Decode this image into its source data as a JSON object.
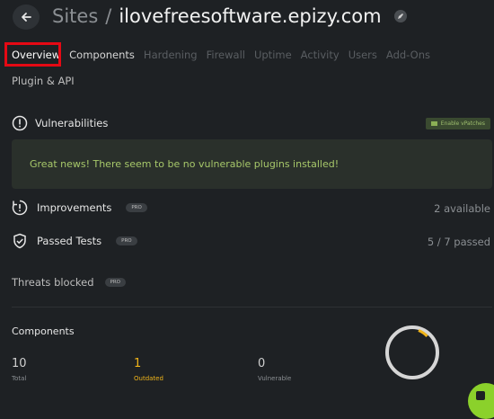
{
  "header": {
    "sites_label": "Sites",
    "separator": "/",
    "domain": "ilovefreesoftware.epizy.com"
  },
  "tabs": [
    {
      "label": "Overview",
      "state": "active"
    },
    {
      "label": "Components",
      "state": "light"
    },
    {
      "label": "Hardening",
      "state": "dim"
    },
    {
      "label": "Firewall",
      "state": "dim"
    },
    {
      "label": "Uptime",
      "state": "dim"
    },
    {
      "label": "Activity",
      "state": "dim"
    },
    {
      "label": "Users",
      "state": "dim"
    },
    {
      "label": "Add-Ons",
      "state": "dim"
    },
    {
      "label": "Plugin & API",
      "state": "light"
    }
  ],
  "vulnerabilities": {
    "title": "Vulnerabilities",
    "vpatch_label": "Enable vPatches",
    "banner_text": "Great news! There seem to be no vulnerable plugins installed!"
  },
  "improvements": {
    "label": "Improvements",
    "badge": "PRO",
    "value": "2 available"
  },
  "passed_tests": {
    "label": "Passed Tests",
    "badge": "PRO",
    "value": "5 / 7 passed"
  },
  "threats": {
    "label": "Threats blocked",
    "badge": "PRO"
  },
  "components": {
    "title": "Components",
    "stats": [
      {
        "value": "10",
        "label": "Total"
      },
      {
        "value": "1",
        "label": "Outdated"
      },
      {
        "value": "0",
        "label": "Vulnerable"
      }
    ]
  },
  "colors": {
    "background": "#1e2124",
    "accent_green": "#8bd12b",
    "warning": "#f0b419",
    "highlight_box": "#e50914"
  }
}
